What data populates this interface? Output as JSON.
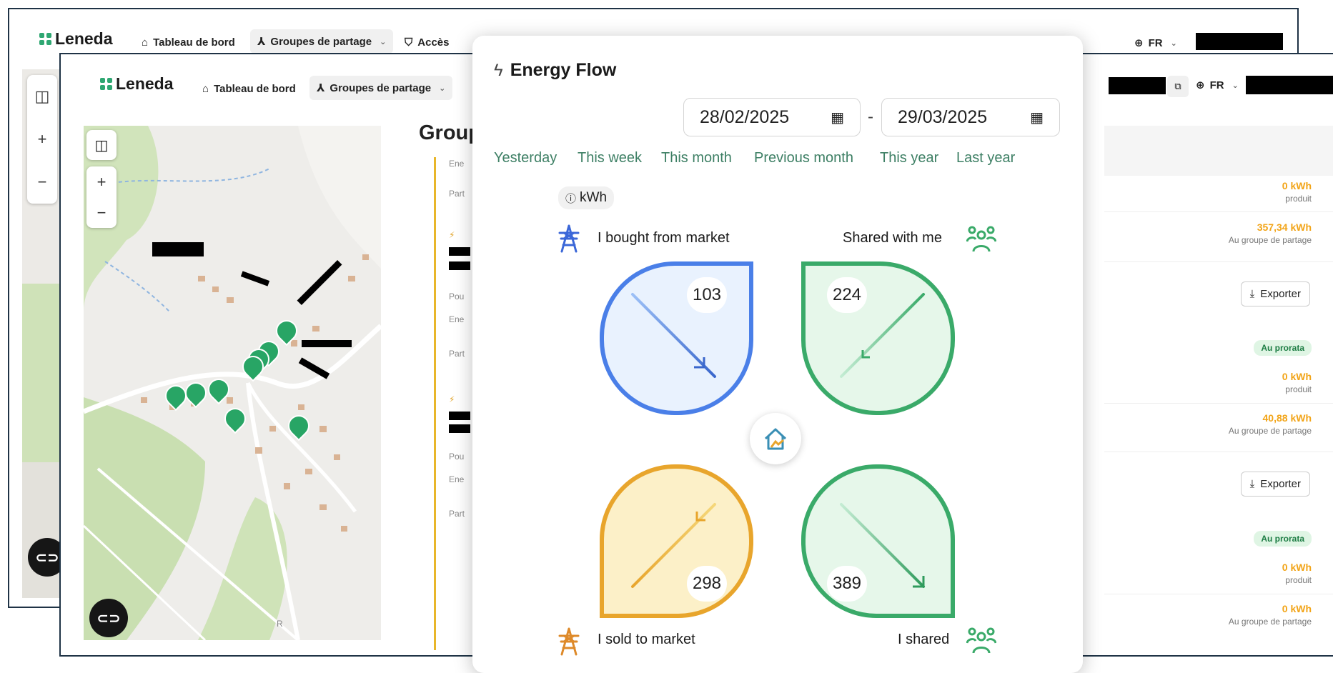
{
  "back_window": {
    "logo_text": "Leneda",
    "nav": {
      "dashboard": "Tableau de bord",
      "groups": "Groupes de partage",
      "access": "Accès"
    },
    "lang": "FR"
  },
  "mid_window": {
    "logo_text": "Leneda",
    "nav": {
      "dashboard": "Tableau de bord",
      "groups": "Groupes de partage"
    },
    "lang": "FR",
    "page_title": "Groupes",
    "list_labels": {
      "energy": "Ene",
      "partage": "Part",
      "puissance": "Pou"
    }
  },
  "right_panel": {
    "rows": [
      {
        "value": "0 kWh",
        "sub": "produit"
      },
      {
        "value": "357,34 kWh",
        "sub": "Au groupe de partage"
      },
      {
        "value": "0 kWh",
        "sub": "produit"
      },
      {
        "value": "40,88 kWh",
        "sub": "Au groupe de partage"
      },
      {
        "value": "0 kWh",
        "sub": "produit"
      },
      {
        "value": "0 kWh",
        "sub": "Au groupe de partage"
      }
    ],
    "export_label": "Exporter",
    "badge_label": "Au prorata"
  },
  "map": {
    "attribution": "R"
  },
  "energy_flow": {
    "title": "Energy Flow",
    "date_from": "28/02/2025",
    "date_separator": "-",
    "date_to": "29/03/2025",
    "presets": [
      "Yesterday",
      "This week",
      "This month",
      "Previous month",
      "This year",
      "Last year"
    ],
    "unit": "kWh",
    "quadrants": {
      "bought": {
        "label": "I bought from market",
        "value": 103,
        "color": "#4a7fe8"
      },
      "shared_with_me": {
        "label": "Shared with me",
        "value": 224,
        "color": "#3aaa69"
      },
      "sold": {
        "label": "I sold to market",
        "value": 298,
        "color": "#e8a52c"
      },
      "shared": {
        "label": "I shared",
        "value": 389,
        "color": "#3aaa69"
      }
    }
  }
}
